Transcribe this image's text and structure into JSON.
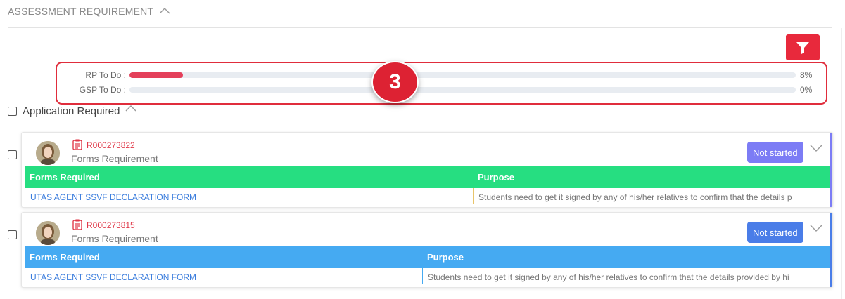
{
  "section": {
    "title": "ASSESSMENT REQUIREMENT"
  },
  "filter": {
    "icon": "filter-icon",
    "color": "#e8293c"
  },
  "progress": [
    {
      "label": "RP To Do :",
      "value": 8,
      "percent_text": "8%"
    },
    {
      "label": "GSP To Do :",
      "value": 0,
      "percent_text": "0%"
    }
  ],
  "step_badge": "3",
  "application_required": {
    "label": "Application Required",
    "checked": false
  },
  "cards": [
    {
      "id": "R000273822",
      "type": "Forms Requirement",
      "status": "Not started",
      "status_color": "#7c7cf5",
      "table_color": "#26de81",
      "accent_color": "#7c7cf5",
      "columns": [
        "Forms Required",
        "Purpose"
      ],
      "row": [
        "UTAS AGENT SSVF DECLARATION FORM",
        "Students need to get it signed by any of his/her relatives to confirm that the details p"
      ]
    },
    {
      "id": "R000273815",
      "type": "Forms Requirement",
      "status": "Not started",
      "status_color": "#4a7de8",
      "table_color": "#45aaf2",
      "accent_color": "#4a7de8",
      "columns": [
        "Forms Required",
        "Purpose"
      ],
      "row": [
        "UTAS AGENT SSVF DECLARATION FORM",
        "Students need to get it signed by any of his/her relatives to confirm that the details provided by hi"
      ]
    }
  ]
}
